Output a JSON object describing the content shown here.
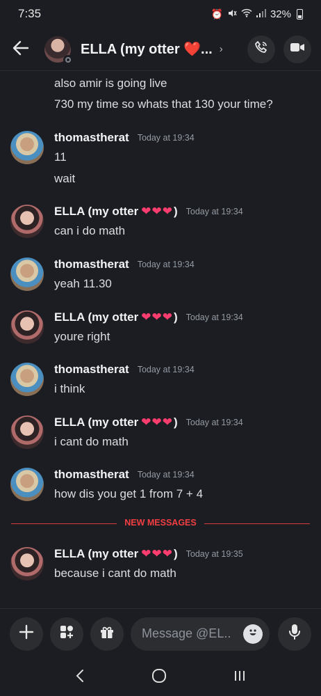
{
  "status_bar": {
    "time": "7:35",
    "battery": "32%",
    "icons": [
      "alarm-icon",
      "mute-icon",
      "wifi-icon",
      "signal-icon",
      "battery-icon"
    ]
  },
  "header": {
    "title": "ELLA (my otter ❤️...",
    "chevron": "›",
    "actions": [
      "call-icon",
      "video-icon"
    ]
  },
  "messages": {
    "continuation": [
      "also amir is going live",
      "730 my time so whats that 130 your time?"
    ],
    "items": [
      {
        "author": "thomastherat",
        "hearts": false,
        "timestamp": "Today at 19:34",
        "lines": [
          "11",
          "wait"
        ]
      },
      {
        "author": "ELLA (my otter",
        "hearts": true,
        "timestamp": "Today at 19:34",
        "lines": [
          "can i do math"
        ]
      },
      {
        "author": "thomastherat",
        "hearts": false,
        "timestamp": "Today at 19:34",
        "lines": [
          "yeah 11.30"
        ]
      },
      {
        "author": "ELLA (my otter",
        "hearts": true,
        "timestamp": "Today at 19:34",
        "lines": [
          "youre right"
        ]
      },
      {
        "author": "thomastherat",
        "hearts": false,
        "timestamp": "Today at 19:34",
        "lines": [
          "i think"
        ]
      },
      {
        "author": "ELLA (my otter",
        "hearts": true,
        "timestamp": "Today at 19:34",
        "lines": [
          "i cant do math"
        ]
      },
      {
        "author": "thomastherat",
        "hearts": false,
        "timestamp": "Today at 19:34",
        "lines": [
          "how dis you get 1 from 7 + 4"
        ]
      },
      {
        "author": "ELLA (my otter",
        "hearts": true,
        "timestamp": "Today at 19:35",
        "lines": [
          "because i cant do math"
        ]
      }
    ],
    "heart_glyph": "❤",
    "close_paren": ")"
  },
  "divider": {
    "label": "NEW MESSAGES",
    "color": "#f23f43"
  },
  "composer": {
    "placeholder": "Message @EL...",
    "buttons": [
      "plus-icon",
      "apps-icon",
      "gift-icon",
      "emoji-icon",
      "mic-icon"
    ]
  },
  "nav": [
    "back-nav-icon",
    "home-nav-icon",
    "recents-nav-icon"
  ],
  "colors": {
    "background": "#1c1d22",
    "accent_heart": "#ff3d6e",
    "new_messages": "#f23f43"
  }
}
